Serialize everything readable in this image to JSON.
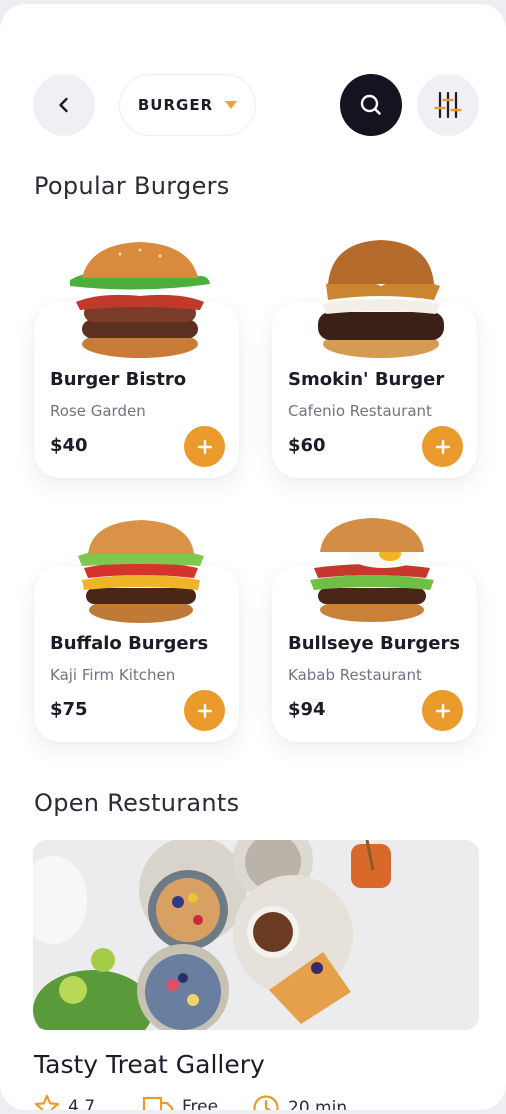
{
  "header": {
    "category": "BURGER"
  },
  "sections": {
    "popular_title": "Popular Burgers",
    "open_title": "Open Resturants"
  },
  "products": [
    {
      "name": "Burger Bistro",
      "restaurant": "Rose Garden",
      "price": "$40"
    },
    {
      "name": "Smokin' Burger",
      "restaurant": "Cafenio Restaurant",
      "price": "$60"
    },
    {
      "name": "Buffalo Burgers",
      "restaurant": "Kaji Firm Kitchen",
      "price": "$75"
    },
    {
      "name": "Bullseye Burgers",
      "restaurant": "Kabab Restaurant",
      "price": "$94"
    }
  ],
  "restaurant": {
    "name": "Tasty Treat Gallery",
    "rating": "4.7",
    "delivery": "Free",
    "time": "20 min"
  },
  "colors": {
    "accent": "#eb9a2c",
    "dark": "#14131f",
    "text": "#1c1c28",
    "muted": "#707482"
  }
}
